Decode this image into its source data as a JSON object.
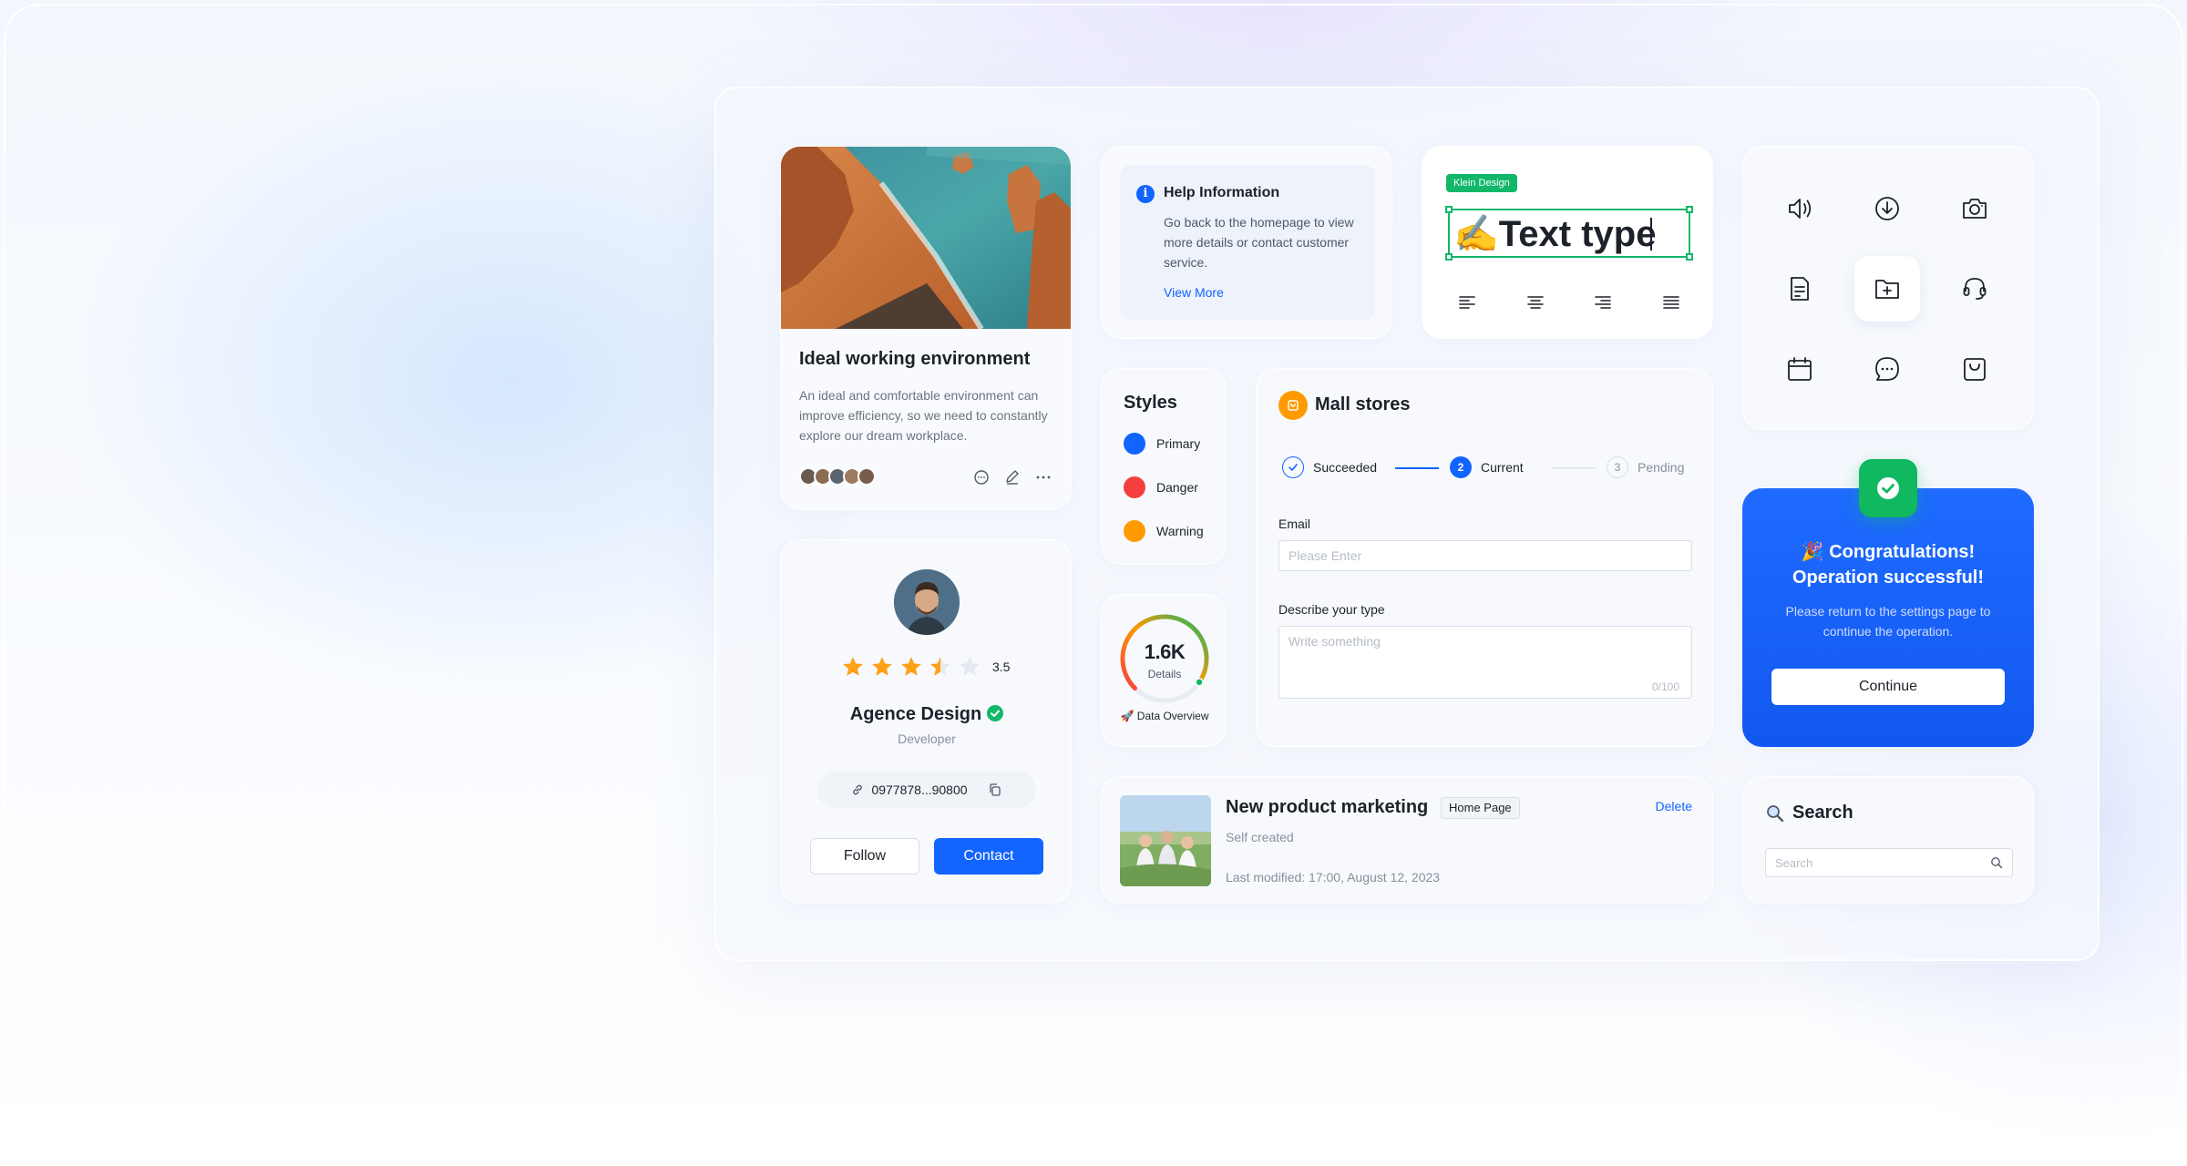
{
  "colors": {
    "primary": "#1264ff",
    "danger": "#f53f3f",
    "warning": "#ff9a00",
    "success": "#12b76a"
  },
  "image_card": {
    "title": "Ideal working environment",
    "description": "An ideal and comfortable environment can improve efficiency, so we need to constantly explore our dream workplace.",
    "avatar_count": 5,
    "actions": [
      "comment-icon",
      "edit-icon",
      "more-icon"
    ]
  },
  "profile_card": {
    "rating": "3.5",
    "rating_value": 3.5,
    "rating_max": 5,
    "name": "Agence Design",
    "role": "Developer",
    "phone": "0977878...90800",
    "follow_label": "Follow",
    "contact_label": "Contact"
  },
  "help_card": {
    "title": "Help Information",
    "body": "Go back to the homepage to view more details or contact customer service.",
    "link": "View More"
  },
  "text_type_card": {
    "tag": "Klein Design",
    "text": "✍️Text type",
    "align_icons": [
      "align-left-icon",
      "align-center-icon",
      "align-right-icon",
      "align-justify-icon"
    ]
  },
  "icon_grid": {
    "icons": [
      "volume-icon",
      "download-icon",
      "camera-icon",
      "document-icon",
      "folder-add-icon",
      "headset-icon",
      "calendar-icon",
      "message-icon",
      "bag-icon"
    ],
    "active": "folder-add-icon"
  },
  "styles_card": {
    "title": "Styles",
    "items": [
      {
        "label": "Primary",
        "color": "#1264ff"
      },
      {
        "label": "Danger",
        "color": "#f53f3f"
      },
      {
        "label": "Warning",
        "color": "#ff9a00"
      }
    ]
  },
  "gauge_card": {
    "value": "1.6K",
    "label": "Details",
    "footer": "🚀 Data Overview",
    "fill_fraction": 0.72
  },
  "mall_card": {
    "title": "Mall stores",
    "steps": [
      {
        "label": "Succeeded",
        "status": "done"
      },
      {
        "number": "2",
        "label": "Current",
        "status": "current"
      },
      {
        "number": "3",
        "label": "Pending",
        "status": "pending"
      }
    ],
    "email_label": "Email",
    "email_placeholder": "Please Enter",
    "describe_label": "Describe your type",
    "describe_placeholder": "Write something",
    "counter": "0/100"
  },
  "success_card": {
    "title_line1": "🎉 Congratulations!",
    "title_line2": "Operation successful!",
    "message": "Please return to the settings page to continue the operation.",
    "button": "Continue"
  },
  "product_card": {
    "name": "New product marketing",
    "tag": "Home Page",
    "subtitle": "Self created",
    "meta": "Last modified: 17:00, August 12, 2023",
    "delete": "Delete"
  },
  "search_card": {
    "title": "Search",
    "placeholder": "Search"
  }
}
